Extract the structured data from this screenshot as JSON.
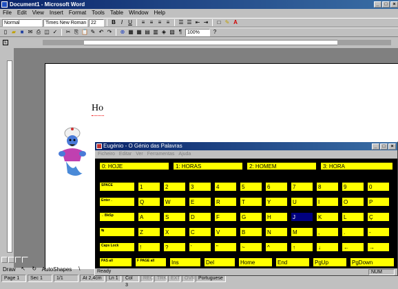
{
  "word": {
    "title": "Document1 - Microsoft Word",
    "menu": [
      "File",
      "Edit",
      "View",
      "Insert",
      "Format",
      "Tools",
      "Table",
      "Window",
      "Help"
    ],
    "format_toolbar": {
      "style": "Normal",
      "font": "Times New Roman",
      "size": "22",
      "bold": "B",
      "italic": "I",
      "underline": "U"
    },
    "standard_toolbar": {
      "zoom": "100%"
    },
    "document_text": "Ho",
    "draw_label": "Draw",
    "autoshapes_label": "AutoShapes",
    "status": {
      "page": "Page 1",
      "sec": "Sec 1",
      "pages": "1/1",
      "at": "At 2,4cm",
      "ln": "Ln 1",
      "col": "Col 3",
      "rec": "REC",
      "trk": "TRK",
      "ext": "EXT",
      "ovr": "OVR",
      "language": "Portuguese",
      "num": "NUM"
    }
  },
  "eugenio": {
    "title": "Eugénio - O Génio das Palavras",
    "menu": [
      "Ficheiro",
      "Editar",
      "Ver",
      "Ferramentas",
      "Ajuda"
    ],
    "status": "Ready",
    "predictions": [
      "0: HOJE",
      "1: HORAS",
      "2: HOMEM",
      "3: HORA"
    ],
    "rows": [
      {
        "fn": "SPACE",
        "keys": [
          "1",
          "2",
          "3",
          "4",
          "5",
          "6",
          "7",
          "8",
          "9",
          "0"
        ]
      },
      {
        "fn": "Enter←",
        "keys": [
          "Q",
          "W",
          "E",
          "R",
          "T",
          "Y",
          "U",
          "I",
          "O",
          "P"
        ]
      },
      {
        "fn": "←BkSp",
        "keys": [
          "A",
          "S",
          "D",
          "F",
          "G",
          "H",
          "J",
          "K",
          "L",
          "Ç"
        ]
      },
      {
        "fn": "↹",
        "keys": [
          "Z",
          "X",
          "C",
          "V",
          "B",
          "N",
          "M",
          ",",
          ".",
          "-"
        ]
      },
      {
        "fn": "Caps Lock",
        "keys": [
          "!",
          "?",
          "'",
          "\"",
          "~",
          "^",
          "↑",
          "↓",
          "←",
          "→"
        ]
      }
    ],
    "bottom_row": {
      "fn1": "PAS all",
      "fn2": "F PAGE all",
      "keys": [
        "Ins",
        "Del",
        "Home",
        "End",
        "PgUp",
        "PgDown"
      ]
    },
    "highlighted_key": "J"
  }
}
